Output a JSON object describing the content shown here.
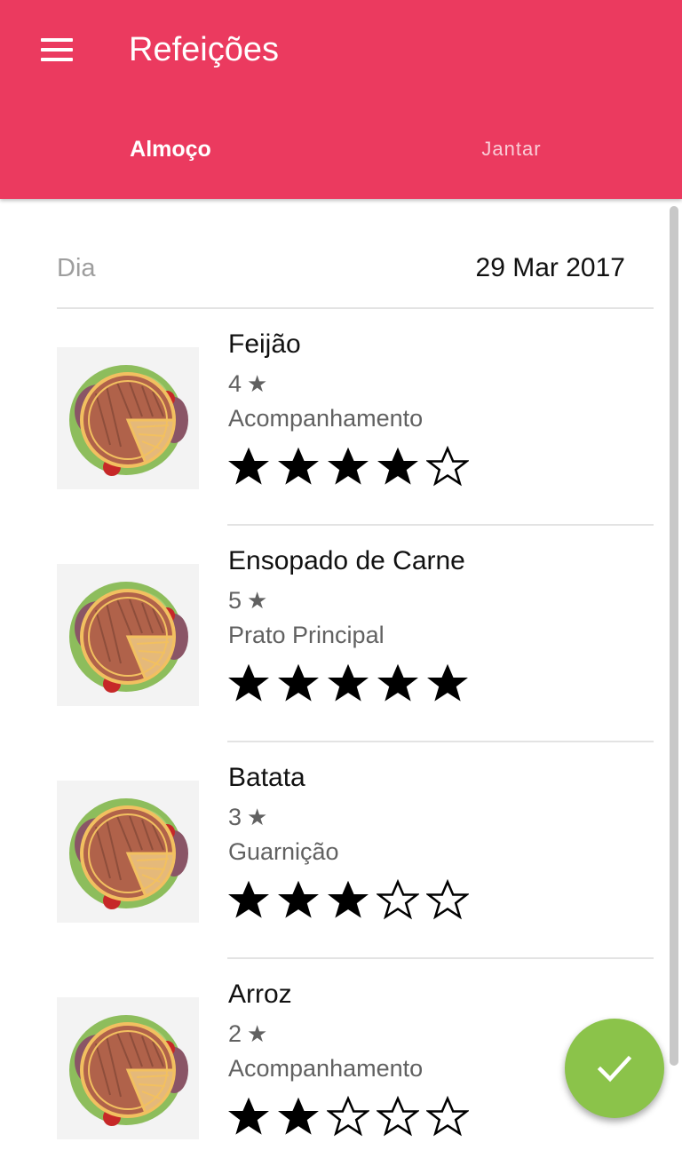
{
  "app_bar": {
    "menu_icon": "hamburger-menu-icon",
    "title": "Refeições",
    "color": "#eb3a5f"
  },
  "tabs": [
    {
      "label": "Almoço",
      "selected": true
    },
    {
      "label": "Jantar",
      "selected": false
    }
  ],
  "day": {
    "label": "Dia",
    "value": "29 Mar 2017"
  },
  "meals": [
    {
      "name": "Feijão",
      "average": "4",
      "category": "Acompanhamento",
      "rating": 4,
      "image_icon": "food-plate-icon"
    },
    {
      "name": "Ensopado de Carne",
      "average": "5",
      "category": "Prato Principal",
      "rating": 5,
      "image_icon": "food-plate-icon"
    },
    {
      "name": "Batata",
      "average": "3",
      "category": "Guarnição",
      "rating": 3,
      "image_icon": "food-plate-icon"
    },
    {
      "name": "Arroz",
      "average": "2",
      "category": "Acompanhamento",
      "rating": 2,
      "image_icon": "food-plate-icon"
    }
  ],
  "fab": {
    "icon": "check-icon",
    "color": "#8bc34a"
  }
}
